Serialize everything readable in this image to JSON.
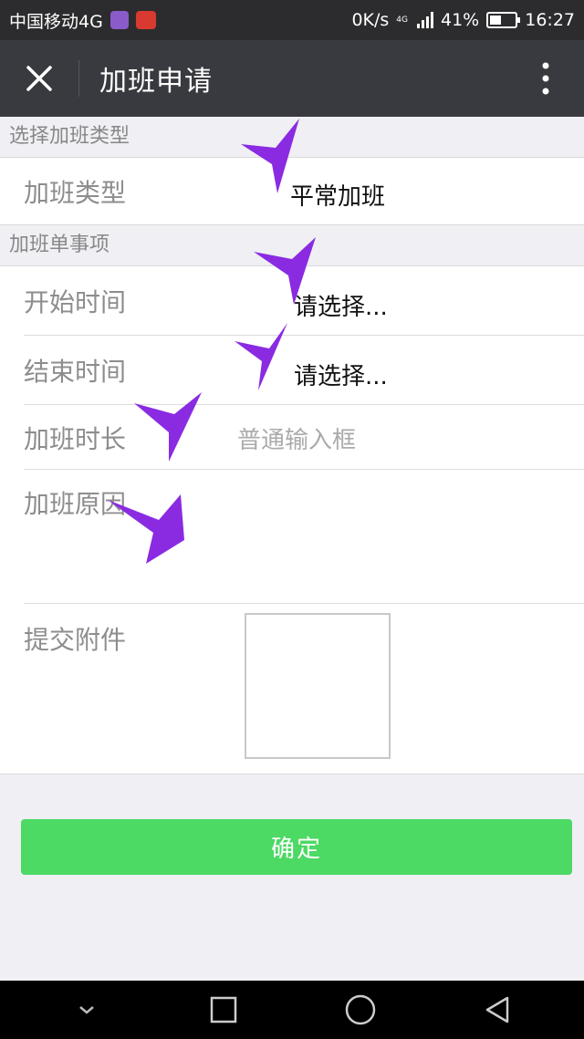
{
  "status_bar": {
    "carrier": "中国移动4G",
    "speed": "0K/s",
    "network": "4G",
    "battery": "41%",
    "time": "16:27"
  },
  "header": {
    "title": "加班申请",
    "close_icon": "close-icon",
    "more_icon": "more-vertical-icon"
  },
  "section_type": {
    "title": "选择加班类型",
    "row": {
      "label": "加班类型",
      "value": "平常加班"
    }
  },
  "section_items": {
    "title": "加班单事项",
    "start": {
      "label": "开始时间",
      "value": "请选择..."
    },
    "end": {
      "label": "结束时间",
      "value": "请选择..."
    },
    "duration": {
      "label": "加班时长",
      "placeholder": "普通输入框"
    },
    "reason": {
      "label": "加班原因"
    },
    "attachment": {
      "label": "提交附件"
    }
  },
  "confirm_label": "确定",
  "colors": {
    "header_bg": "#393a3f",
    "confirm_green": "#4cd964",
    "annotation_purple": "#8a2be2"
  }
}
